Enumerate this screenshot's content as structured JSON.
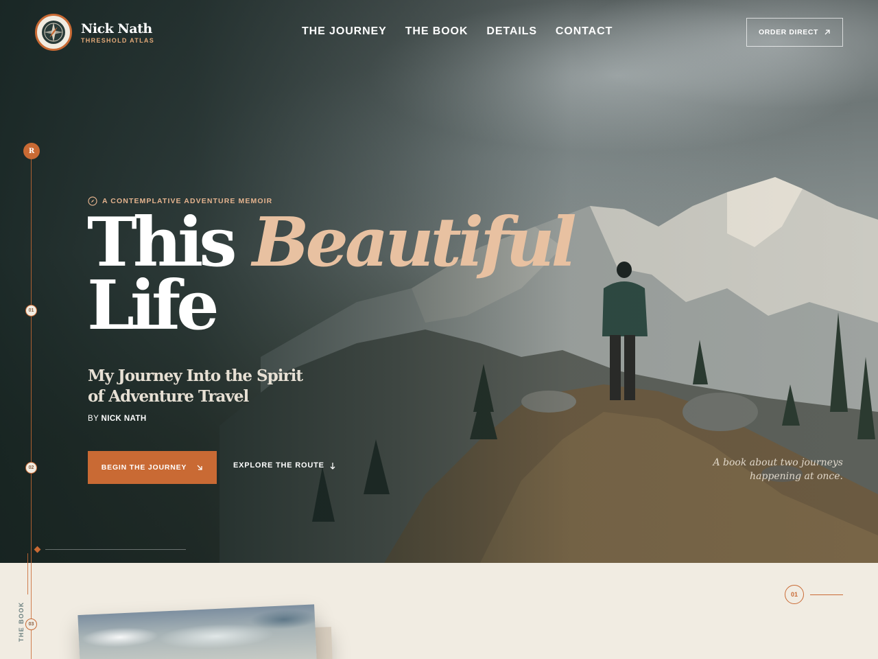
{
  "brand": {
    "name": "Nick Nath",
    "subtitle": "THRESHOLD ATLAS"
  },
  "nav": {
    "items": [
      {
        "label": "THE JOURNEY"
      },
      {
        "label": "THE BOOK"
      },
      {
        "label": "DETAILS"
      },
      {
        "label": "CONTACT"
      }
    ]
  },
  "header": {
    "order_label": "ORDER DIRECT"
  },
  "rail": {
    "top_marker": "R",
    "markers": [
      "01",
      "02",
      "03"
    ],
    "section_label": "THE BOOK"
  },
  "hero": {
    "eyebrow": "A CONTEMPLATIVE ADVENTURE MEMOIR",
    "title_line1": "This",
    "title_accent": "Beautiful",
    "title_line2": "Life",
    "subtitle": "My Journey Into the Spirit of Adventure Travel",
    "byline_prefix": "BY",
    "byline_author": "NICK NATH",
    "primary_cta": "BEGIN THE JOURNEY",
    "secondary_cta": "EXPLORE THE ROUTE",
    "tagline_line1": "A book about two journeys",
    "tagline_line2": "happening at once."
  },
  "book_section": {
    "number": "01"
  },
  "colors": {
    "accent": "#c96a34",
    "accent_light": "#e8c1a1",
    "cream": "#f1ece2",
    "dark_green": "#1f3331"
  },
  "icons": {
    "logo": "compass-icon",
    "order": "arrow-up-right-icon",
    "primary_cta": "arrow-down-right-icon",
    "secondary_cta": "arrow-down-icon",
    "eyebrow": "compass-small-icon"
  }
}
